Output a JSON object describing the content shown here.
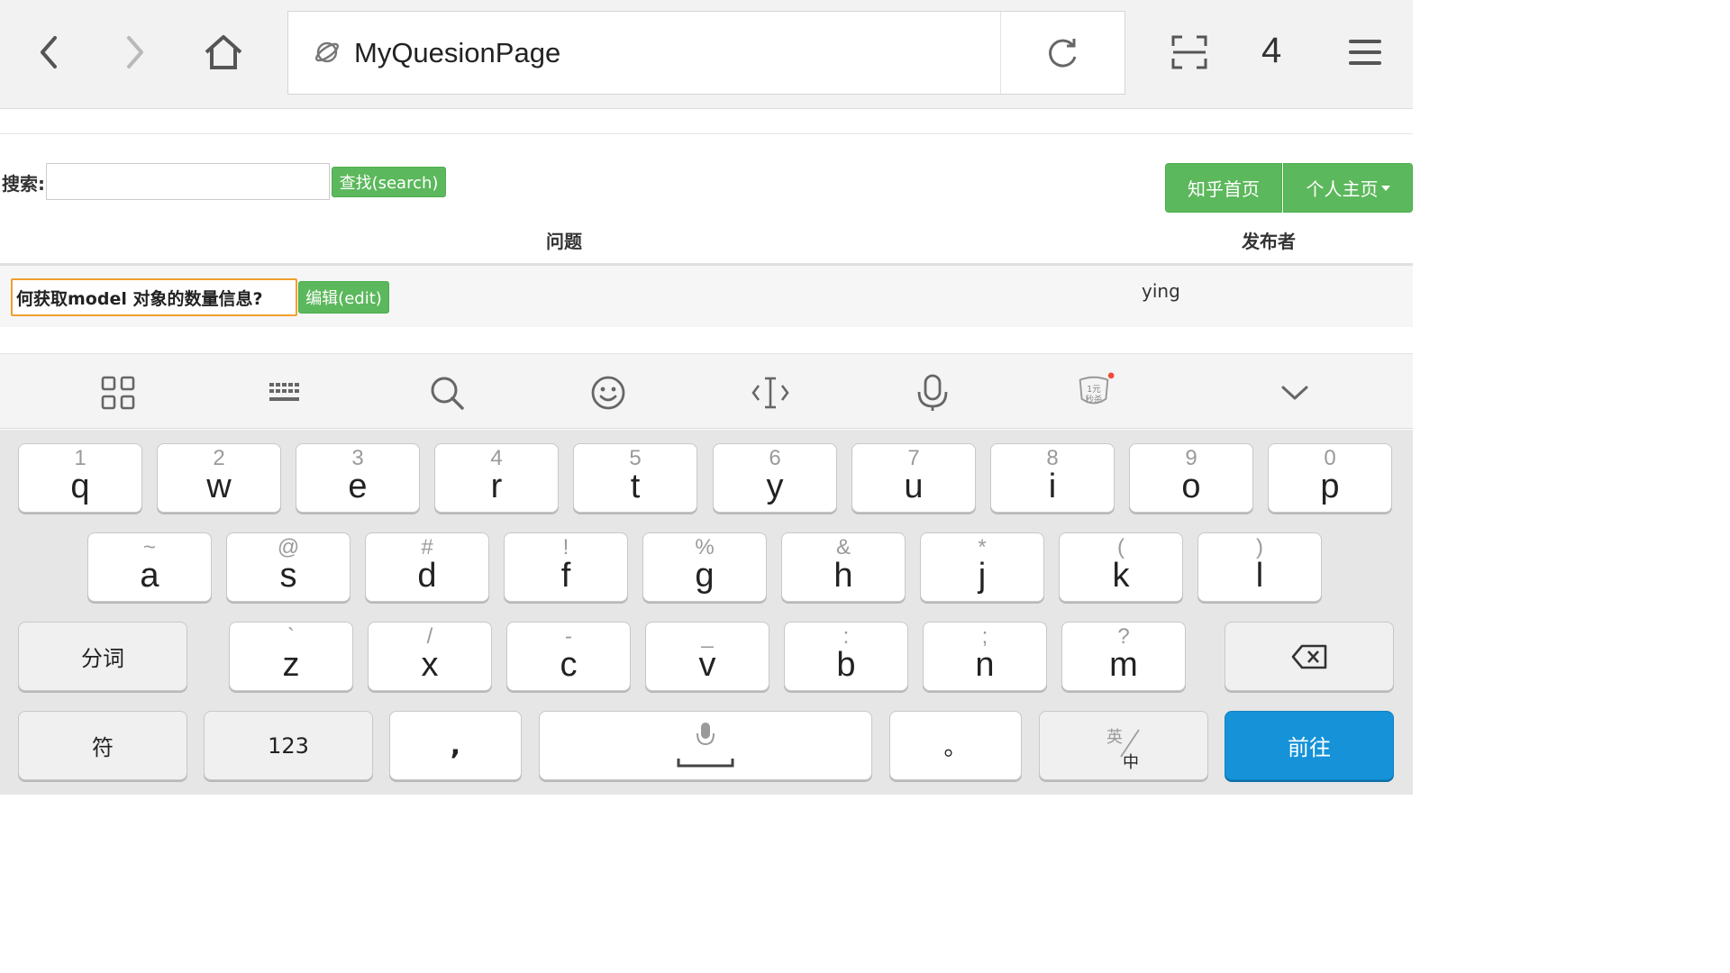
{
  "browser": {
    "url_text": "MyQuesionPage",
    "tab_count": "4",
    "icons": [
      "back-icon",
      "forward-icon",
      "home-icon",
      "globe-icon",
      "reload-icon",
      "scan-icon",
      "menu-icon"
    ]
  },
  "page": {
    "search_label": "搜索:",
    "search_placeholder": "",
    "search_button": "查找(search)",
    "nav_home": "知乎首页",
    "nav_personal": "个人主页",
    "col_question": "问题",
    "col_publisher": "发布者",
    "rows": [
      {
        "question": "何获取model 对象的数量信息?",
        "edit_label": "编辑(edit)",
        "publisher": "ying"
      }
    ]
  },
  "keyboard_tools": [
    "apps-icon",
    "keyboard-icon",
    "search-icon",
    "emoji-icon",
    "cursor-icon",
    "microphone-icon",
    "promo-icon",
    "collapse-icon"
  ],
  "promo_text": "1元秒杀",
  "keyboard": {
    "row1": [
      {
        "hint": "1",
        "key": "q"
      },
      {
        "hint": "2",
        "key": "w"
      },
      {
        "hint": "3",
        "key": "e"
      },
      {
        "hint": "4",
        "key": "r"
      },
      {
        "hint": "5",
        "key": "t"
      },
      {
        "hint": "6",
        "key": "y"
      },
      {
        "hint": "7",
        "key": "u"
      },
      {
        "hint": "8",
        "key": "i"
      },
      {
        "hint": "9",
        "key": "o"
      },
      {
        "hint": "0",
        "key": "p"
      }
    ],
    "row2": [
      {
        "hint": "~",
        "key": "a"
      },
      {
        "hint": "@",
        "key": "s"
      },
      {
        "hint": "#",
        "key": "d"
      },
      {
        "hint": "!",
        "key": "f"
      },
      {
        "hint": "%",
        "key": "g"
      },
      {
        "hint": "&",
        "key": "h"
      },
      {
        "hint": "*",
        "key": "j"
      },
      {
        "hint": "(",
        "key": "k"
      },
      {
        "hint": ")",
        "key": "l"
      }
    ],
    "row3": [
      {
        "hint": "`",
        "key": "z"
      },
      {
        "hint": "/",
        "key": "x"
      },
      {
        "hint": "-",
        "key": "c"
      },
      {
        "hint": "_",
        "key": "v"
      },
      {
        "hint": ":",
        "key": "b"
      },
      {
        "hint": ";",
        "key": "n"
      },
      {
        "hint": "?",
        "key": "m"
      }
    ],
    "segment": "分词",
    "symbols": "符",
    "numbers": "123",
    "comma": ",",
    "period": "。",
    "lang_en": "英",
    "lang_zh": "中",
    "go": "前往",
    "accent_color": "#1592d8",
    "button_color": "#5cb85c"
  }
}
